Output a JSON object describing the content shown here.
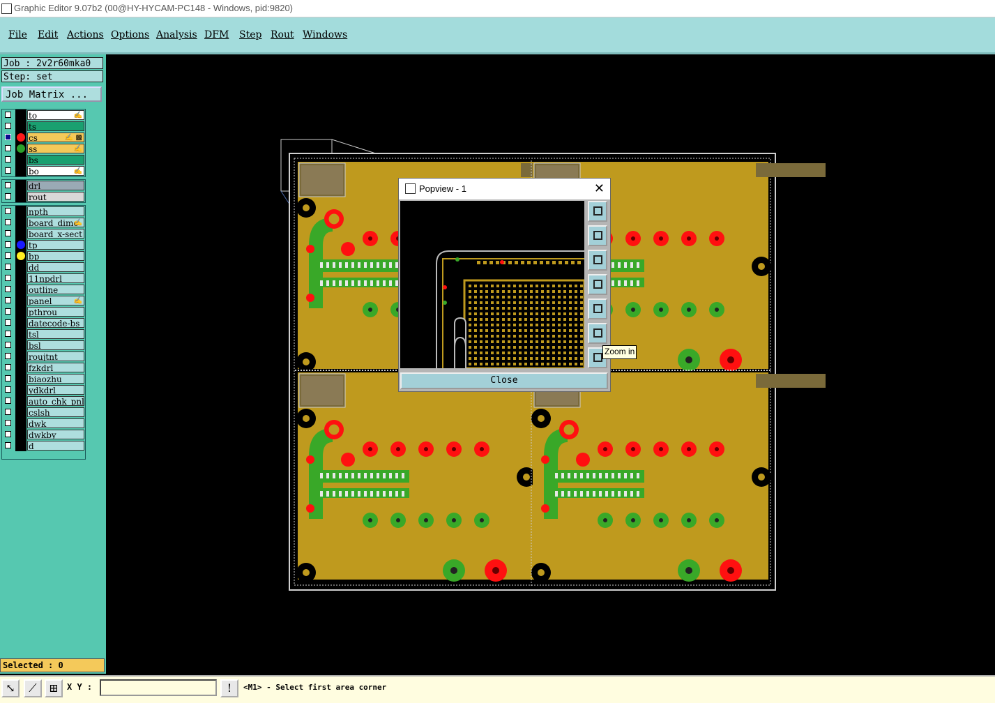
{
  "window": {
    "title": "Graphic Editor 9.07b2 (00@HY-HYCAM-PC148 - Windows, pid:9820)"
  },
  "menu": [
    "File",
    "Edit",
    "Actions",
    "Options",
    "Analysis",
    "DFM",
    "Step",
    "Rout",
    "Windows"
  ],
  "job": {
    "job_label": "Job : 2v2r60mka0",
    "step_label": "Step: set",
    "matrix_button": "Job Matrix ..."
  },
  "layers": {
    "group1": [
      {
        "name": "to",
        "bg": "#ffffff",
        "dot": "",
        "mark": "✍",
        "checked": false
      },
      {
        "name": "ts",
        "bg": "#1aa070",
        "dot": "",
        "mark": "",
        "checked": false
      },
      {
        "name": "cs",
        "bg": "#f4c95a",
        "dot": "#ff1a1a",
        "mark": "✍ ▩",
        "checked": true
      },
      {
        "name": "ss",
        "bg": "#f4c95a",
        "dot": "#2aa02a",
        "mark": "✍",
        "checked": false
      },
      {
        "name": "bs",
        "bg": "#1aa070",
        "dot": "",
        "mark": "",
        "checked": false
      },
      {
        "name": "bo",
        "bg": "#ffffff",
        "dot": "",
        "mark": "✍",
        "checked": false
      }
    ],
    "group2": [
      {
        "name": "drl",
        "bg": "#9aaab5",
        "dot": "",
        "mark": "",
        "checked": false
      },
      {
        "name": "rout",
        "bg": "#d8d8d8",
        "dot": "",
        "mark": "",
        "checked": false
      }
    ],
    "group3": [
      {
        "name": "npth",
        "bg": "#aedede",
        "dot": "",
        "mark": "",
        "checked": false
      },
      {
        "name": "board_dime",
        "bg": "#aedede",
        "dot": "",
        "mark": "✍",
        "checked": false
      },
      {
        "name": "board_x-sect",
        "bg": "#aedede",
        "dot": "",
        "mark": "",
        "checked": false
      },
      {
        "name": "tp",
        "bg": "#aedede",
        "dot": "#1a1aff",
        "mark": "",
        "checked": false
      },
      {
        "name": "bp",
        "bg": "#aedede",
        "dot": "#ffee22",
        "mark": "",
        "checked": false
      },
      {
        "name": "dd",
        "bg": "#aedede",
        "dot": "",
        "mark": "",
        "checked": false
      },
      {
        "name": "11npdrl",
        "bg": "#aedede",
        "dot": "",
        "mark": "",
        "checked": false
      },
      {
        "name": "outline",
        "bg": "#aedede",
        "dot": "",
        "mark": "",
        "checked": false
      },
      {
        "name": "panel",
        "bg": "#aedede",
        "dot": "",
        "mark": "✍",
        "checked": false
      },
      {
        "name": "pthrou",
        "bg": "#aedede",
        "dot": "",
        "mark": "",
        "checked": false
      },
      {
        "name": "datecode-bs",
        "bg": "#aedede",
        "dot": "",
        "mark": "",
        "checked": false
      },
      {
        "name": "tsl",
        "bg": "#aedede",
        "dot": "",
        "mark": "",
        "checked": false
      },
      {
        "name": "bsl",
        "bg": "#aedede",
        "dot": "",
        "mark": "",
        "checked": false
      },
      {
        "name": "roujtnt",
        "bg": "#aedede",
        "dot": "",
        "mark": "",
        "checked": false
      },
      {
        "name": "fzkdrl",
        "bg": "#aedede",
        "dot": "",
        "mark": "",
        "checked": false
      },
      {
        "name": "biaozhu",
        "bg": "#aedede",
        "dot": "",
        "mark": "",
        "checked": false
      },
      {
        "name": "ydkdrl",
        "bg": "#aedede",
        "dot": "",
        "mark": "",
        "checked": false
      },
      {
        "name": "auto_chk_pnl",
        "bg": "#aedede",
        "dot": "",
        "mark": "",
        "checked": false
      },
      {
        "name": "cslsh",
        "bg": "#aedede",
        "dot": "",
        "mark": "",
        "checked": false
      },
      {
        "name": "dwk",
        "bg": "#aedede",
        "dot": "",
        "mark": "",
        "checked": false
      },
      {
        "name": "dwkby",
        "bg": "#aedede",
        "dot": "",
        "mark": "",
        "checked": false
      },
      {
        "name": "d",
        "bg": "#aedede",
        "dot": "",
        "mark": "",
        "checked": false
      }
    ]
  },
  "selected": "Selected : 0",
  "status": {
    "xy_label": "X Y :",
    "xy_value": "",
    "message": "<M1> - Select first area corner"
  },
  "popview": {
    "title": "Popview - 1",
    "close_label": "Close",
    "tooltip": "Zoom in",
    "tools": [
      "zoom-in-icon",
      "pan-up-icon",
      "pan-down-icon",
      "pan-left-icon",
      "pan-right-icon",
      "fit-icon",
      "zoom-area-icon"
    ]
  },
  "colors": {
    "board": "#bf9a1e",
    "copper": "#39a828",
    "pad_red": "#ff1010",
    "frame": "#c8c8c8"
  }
}
